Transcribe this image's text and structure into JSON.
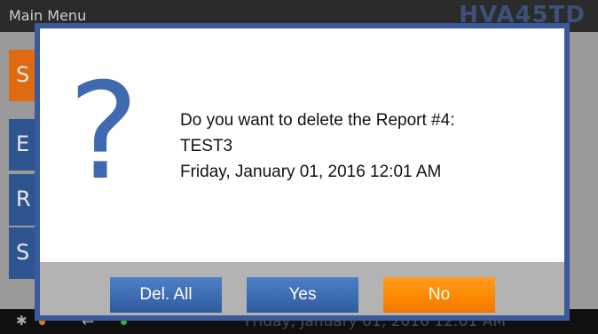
{
  "background": {
    "menu_title": "Main Menu",
    "model": "HVA45TD",
    "side_buttons": [
      "S",
      "E",
      "R",
      "S"
    ],
    "status_date": "Friday, January 01, 2016 12:01 AM"
  },
  "dialog": {
    "icon": "question-mark-icon",
    "message_lines": [
      "Do you want to delete the Report #4:",
      "TEST3",
      "Friday, January 01, 2016 12:01 AM"
    ],
    "buttons": {
      "del_all": "Del. All",
      "yes": "Yes",
      "no": "No"
    }
  },
  "colors": {
    "dialog_border": "#3a5a9c",
    "button_blue": "#3d6cb3",
    "button_orange": "#ff8a00",
    "icon_blue": "#3f6ab0"
  }
}
